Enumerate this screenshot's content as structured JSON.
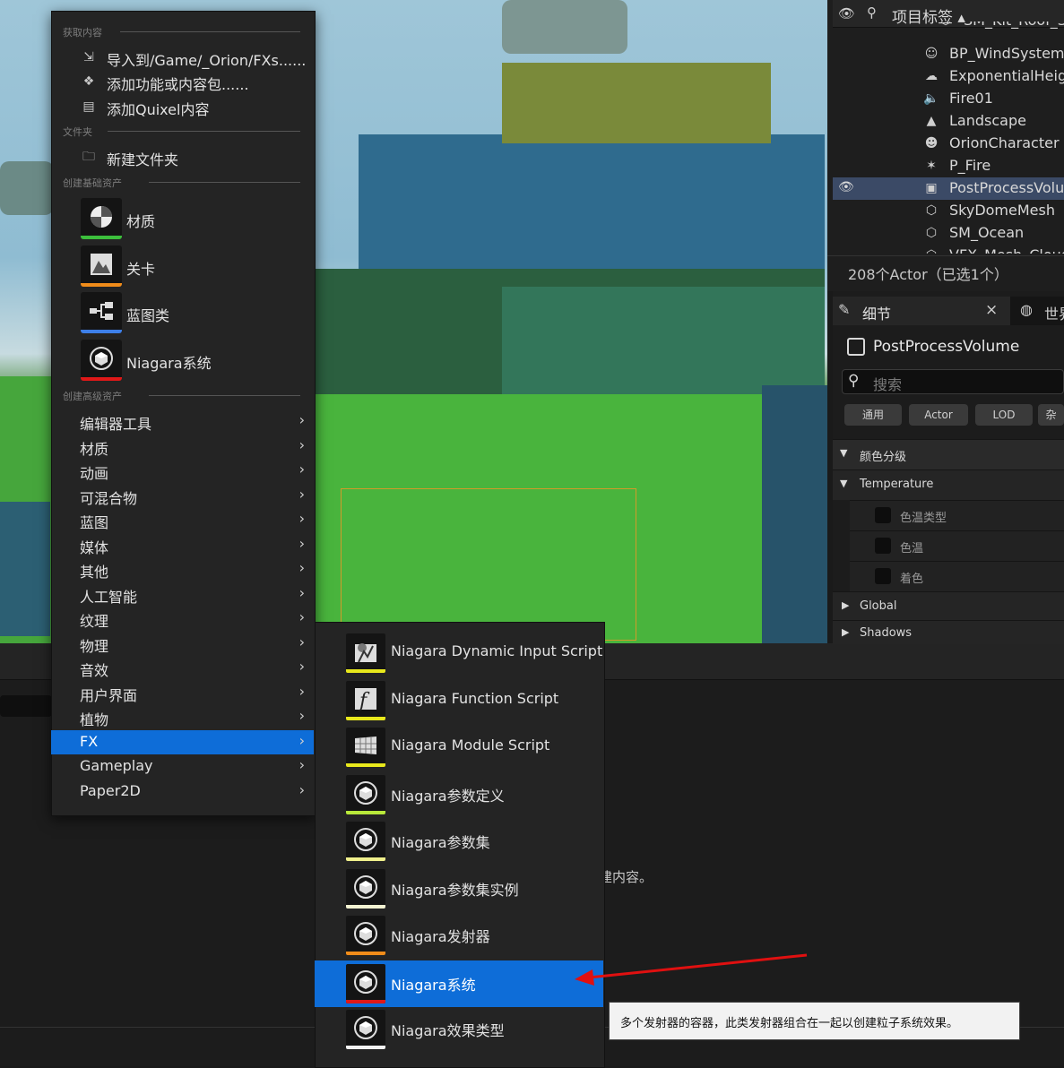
{
  "menu": {
    "sections": {
      "get_content": "获取内容",
      "folder": "文件夹",
      "basic_assets": "创建基础资产",
      "advanced_assets": "创建高级资产"
    },
    "get_content_items": [
      "导入到/Game/_Orion/FXs......",
      "添加功能或内容包......",
      "添加Quixel内容"
    ],
    "folder_items": [
      "新建文件夹"
    ],
    "basic_assets": [
      {
        "label": "材质",
        "color": "#3cbf3c",
        "icon": "material-icon"
      },
      {
        "label": "关卡",
        "color": "#f08c1a",
        "icon": "level-icon"
      },
      {
        "label": "蓝图类",
        "color": "#3d7fe8",
        "icon": "blueprint-icon"
      },
      {
        "label": "Niagara系统",
        "color": "#e01818",
        "icon": "niagara-icon"
      }
    ],
    "advanced_assets": [
      "编辑器工具",
      "材质",
      "动画",
      "可混合物",
      "蓝图",
      "媒体",
      "其他",
      "人工智能",
      "纹理",
      "物理",
      "音效",
      "用户界面",
      "植物",
      "FX",
      "Gameplay",
      "Paper2D"
    ],
    "highlighted": "FX"
  },
  "submenu": {
    "items": [
      {
        "label": "Niagara Dynamic Input Script",
        "color": "#e8e81c",
        "icon": "dynamic-input-icon"
      },
      {
        "label": "Niagara Function Script",
        "color": "#e8e81c",
        "icon": "function-icon"
      },
      {
        "label": "Niagara Module Script",
        "color": "#e8e81c",
        "icon": "module-icon"
      },
      {
        "label": "Niagara参数定义",
        "color": "#b8e83a",
        "icon": "niagara-icon"
      },
      {
        "label": "Niagara参数集",
        "color": "#f0f08c",
        "icon": "niagara-icon"
      },
      {
        "label": "Niagara参数集实例",
        "color": "#f2f2d2",
        "icon": "niagara-icon"
      },
      {
        "label": "Niagara发射器",
        "color": "#f08c1a",
        "icon": "niagara-icon"
      },
      {
        "label": "Niagara系统",
        "color": "#e01818",
        "icon": "niagara-icon"
      },
      {
        "label": "Niagara效果类型",
        "color": "#f2f2f2",
        "icon": "niagara-icon"
      }
    ],
    "highlighted": "Niagara系统"
  },
  "tooltip": "多个发射器的容器，此类发射器组合在一起以创建粒子系统效果。",
  "outliner": {
    "header": "项目标签 ▴",
    "rows": [
      {
        "label": "SM_Kit_Roof_S",
        "icon": "mesh-icon"
      },
      {
        "label": "BP_WindSystem",
        "icon": "actor-icon"
      },
      {
        "label": "ExponentialHeigh",
        "icon": "fog-icon"
      },
      {
        "label": "Fire01",
        "icon": "sound-icon"
      },
      {
        "label": "Landscape",
        "icon": "landscape-icon"
      },
      {
        "label": "OrionCharacter",
        "icon": "character-icon"
      },
      {
        "label": "P_Fire",
        "icon": "particle-icon"
      },
      {
        "label": "PostProcessVolu",
        "icon": "volume-icon",
        "selected": true
      },
      {
        "label": "SkyDomeMesh",
        "icon": "mesh-icon"
      },
      {
        "label": "SM_Ocean",
        "icon": "mesh-icon"
      },
      {
        "label": "VFX_Mesh_Cloud",
        "icon": "mesh-icon"
      }
    ],
    "count": "208个Actor（已选1个）"
  },
  "details": {
    "tab_label": "细节",
    "tab2_label": "世界",
    "close": "×",
    "object_name": "PostProcessVolume",
    "search_placeholder": "搜索",
    "filters": [
      "通用",
      "Actor",
      "LOD",
      "杂"
    ],
    "categories": {
      "color_grading": "颜色分级",
      "temperature": "Temperature",
      "temp_type": "色温类型",
      "temp": "色温",
      "tint": "着色",
      "global": "Global",
      "shadows": "Shadows"
    }
  },
  "content_browser": {
    "empty_text": "建内容。"
  }
}
